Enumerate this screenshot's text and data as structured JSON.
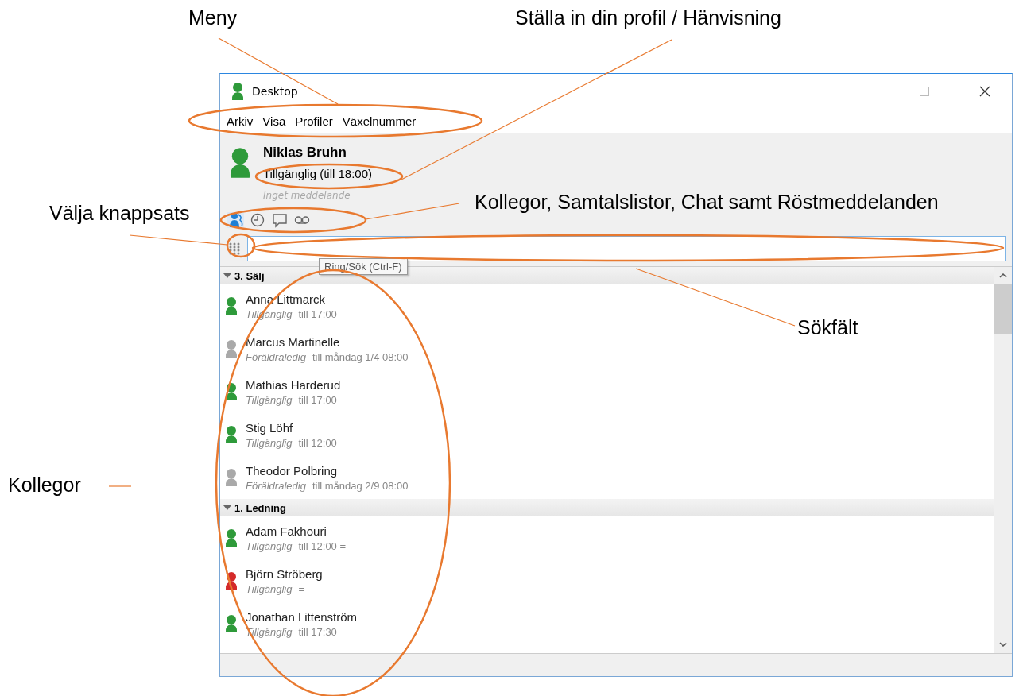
{
  "annotations": [
    {
      "label": "Meny"
    },
    {
      "label": "Ställa in din profil / Hänvisning"
    },
    {
      "label": "Kollegor, Samtalslistor, Chat samt Röstmeddelanden"
    },
    {
      "label": "Välja knappsats"
    },
    {
      "label": "Sökfält"
    },
    {
      "label": "Kollegor"
    }
  ],
  "window": {
    "title": "Desktop"
  },
  "menu": [
    "Arkiv",
    "Visa",
    "Profiler",
    "Växelnummer"
  ],
  "profile": {
    "name": "Niklas Bruhn",
    "status": "Tillgänglig (till 18:00)",
    "message": "Inget meddelande",
    "color": "#2e9a3a"
  },
  "tabs": [
    {
      "kind": "contacts",
      "selected": true
    },
    {
      "kind": "history",
      "selected": false
    },
    {
      "kind": "chat",
      "selected": false
    },
    {
      "kind": "voicemail",
      "selected": false
    }
  ],
  "search": {
    "tooltip": "Ring/Sök (Ctrl-F)"
  },
  "groups": [
    {
      "title": "3. Sälj",
      "expanded": true,
      "contacts": [
        {
          "name": "Anna Littmarck",
          "status": "Tillgänglig",
          "note": "till 17:00",
          "color": "#2e9a3a"
        },
        {
          "name": "Marcus Martinelle",
          "status": "Föräldraledig",
          "note": "till måndag 1/4 08:00",
          "color": "#a9a9a9"
        },
        {
          "name": "Mathias Harderud",
          "status": "Tillgänglig",
          "note": "till 17:00",
          "color": "#2e9a3a"
        },
        {
          "name": "Stig Löhf",
          "status": "Tillgänglig",
          "note": "till 12:00",
          "color": "#2e9a3a"
        },
        {
          "name": "Theodor Polbring",
          "status": "Föräldraledig",
          "note": "till måndag 2/9 08:00",
          "color": "#a9a9a9"
        }
      ]
    },
    {
      "title": "1. Ledning",
      "expanded": true,
      "contacts": [
        {
          "name": "Adam Fakhouri",
          "status": "Tillgänglig",
          "note": "till 12:00 =",
          "color": "#2e9a3a"
        },
        {
          "name": "Björn Ströberg",
          "status": "Tillgänglig",
          "note": "=",
          "color": "#d42a2a"
        },
        {
          "name": "Jonathan Littenström",
          "status": "Tillgänglig",
          "note": "till 17:30",
          "color": "#2e9a3a"
        }
      ]
    }
  ]
}
